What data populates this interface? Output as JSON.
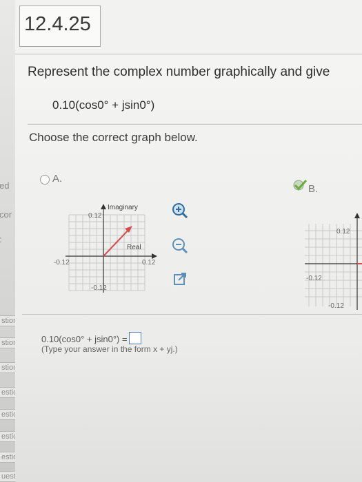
{
  "question": {
    "number": "12.4.25",
    "prompt": "Represent the complex number graphically and give",
    "expression": "0.10(cos0° + jsin0°)",
    "instruction": "Choose the correct graph below."
  },
  "options": [
    {
      "label": "A.",
      "axis_imag": "Imaginary",
      "axis_real": "Real",
      "tick_top": "0.12",
      "tick_bottom": "-0.12",
      "tick_left": "-0.12",
      "tick_right": "0.12"
    },
    {
      "label": "B.",
      "tick_top": "0.12",
      "tick_bottom": "-0.12",
      "tick_left": "-0.12"
    }
  ],
  "answer": {
    "lhs": "0.10(cos0° + jsin0°) =",
    "hint": "(Type your answer in the form x + yj.)",
    "value": ""
  },
  "sidebar": {
    "fragments": [
      "ed",
      "cor",
      ":"
    ],
    "question_links": [
      "stion",
      "stion",
      "stion",
      "estion",
      "estion",
      "estion",
      "estion",
      "uestion"
    ]
  },
  "colors": {
    "vector": "#d84b4b",
    "grid": "#c9c9c9",
    "zoom_icon": "#2e6d9e",
    "selected_check": "#6aaa3a"
  },
  "icons": [
    "zoom-in-icon",
    "zoom-out-icon",
    "popout-icon",
    "check-icon"
  ]
}
